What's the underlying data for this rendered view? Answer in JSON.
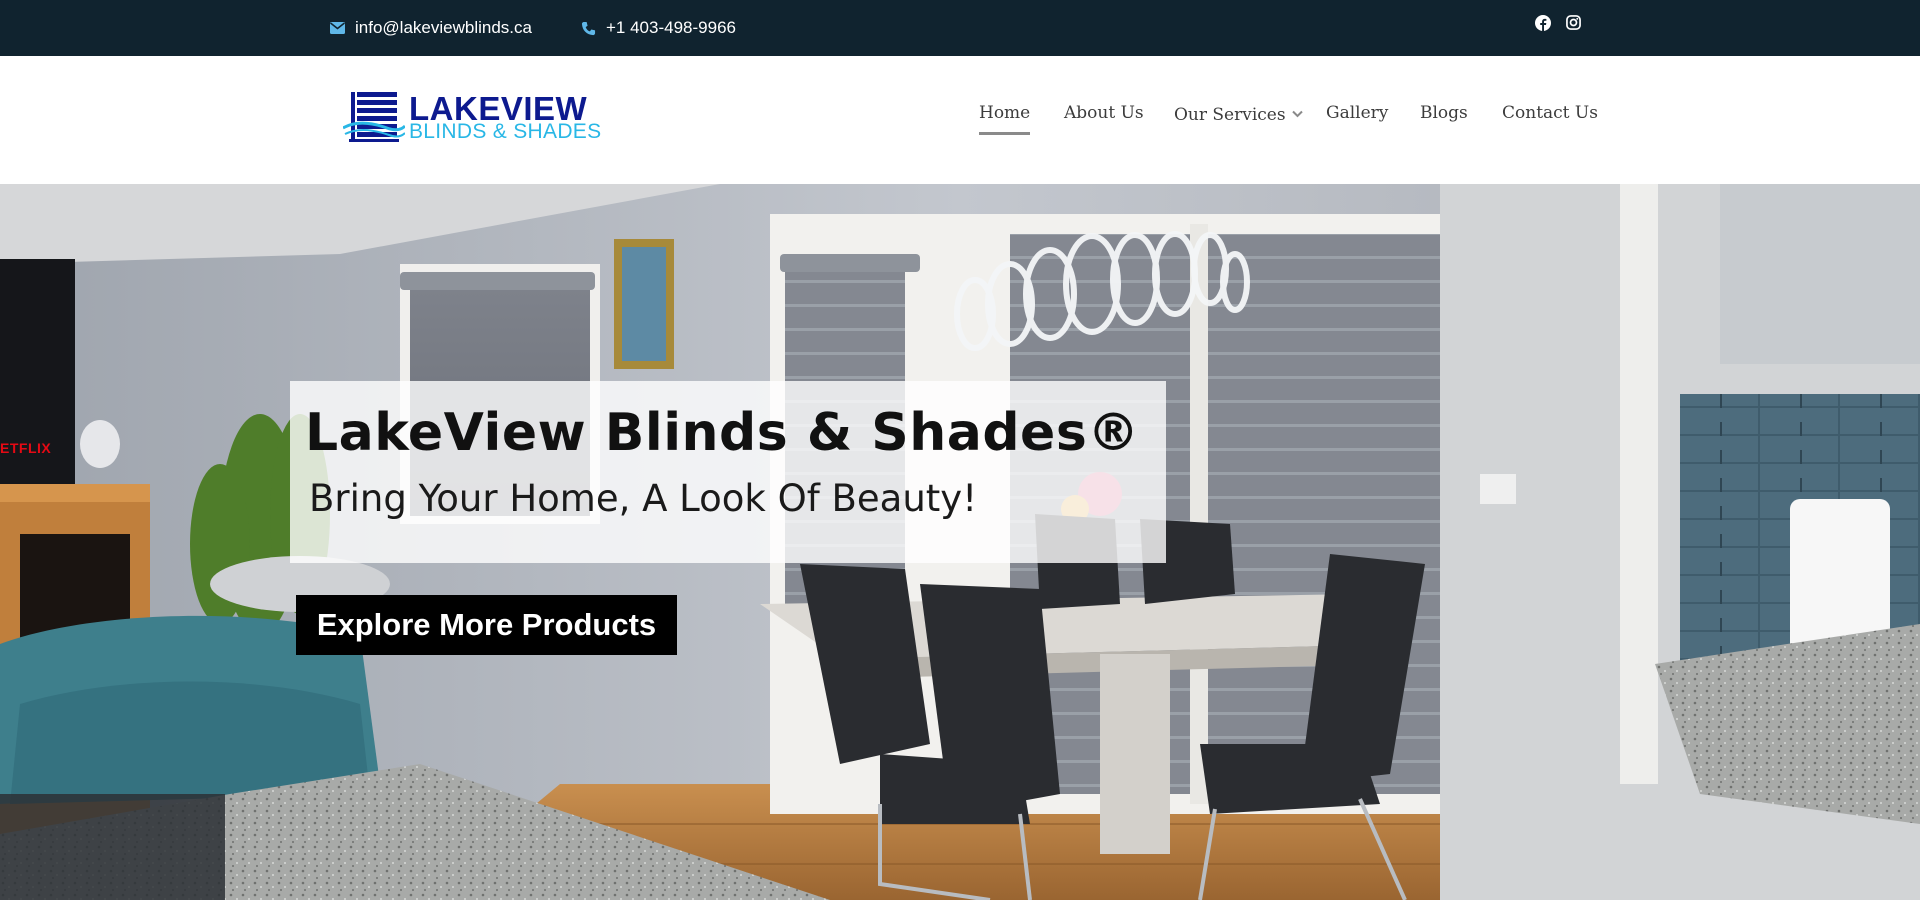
{
  "topbar": {
    "email": "info@lakeviewblinds.ca",
    "phone": "+1 403-498-9966",
    "icons": {
      "email": "envelope-icon",
      "phone": "phone-icon",
      "facebook": "facebook-icon",
      "instagram": "instagram-icon"
    }
  },
  "header": {
    "logo": {
      "line1": "LAKEVIEW",
      "line2": "BLINDS & SHADES"
    },
    "nav": [
      {
        "label": "Home",
        "active": true
      },
      {
        "label": "About Us"
      },
      {
        "label": "Our Services",
        "has_dropdown": true
      },
      {
        "label": "Gallery"
      },
      {
        "label": "Blogs"
      },
      {
        "label": "Contact Us"
      }
    ]
  },
  "hero": {
    "title": "LakeView Blinds & Shades®",
    "subtitle": "Bring Your Home, A Look Of Beauty!",
    "cta": "Explore More Products",
    "tv_brand": "ETFLIX"
  },
  "colors": {
    "topbar_bg": "#10232f",
    "logo_navy": "#0d1a8f",
    "logo_cyan": "#29b7e6",
    "nav_text": "#3c3c3c",
    "cta_bg": "#000000"
  }
}
